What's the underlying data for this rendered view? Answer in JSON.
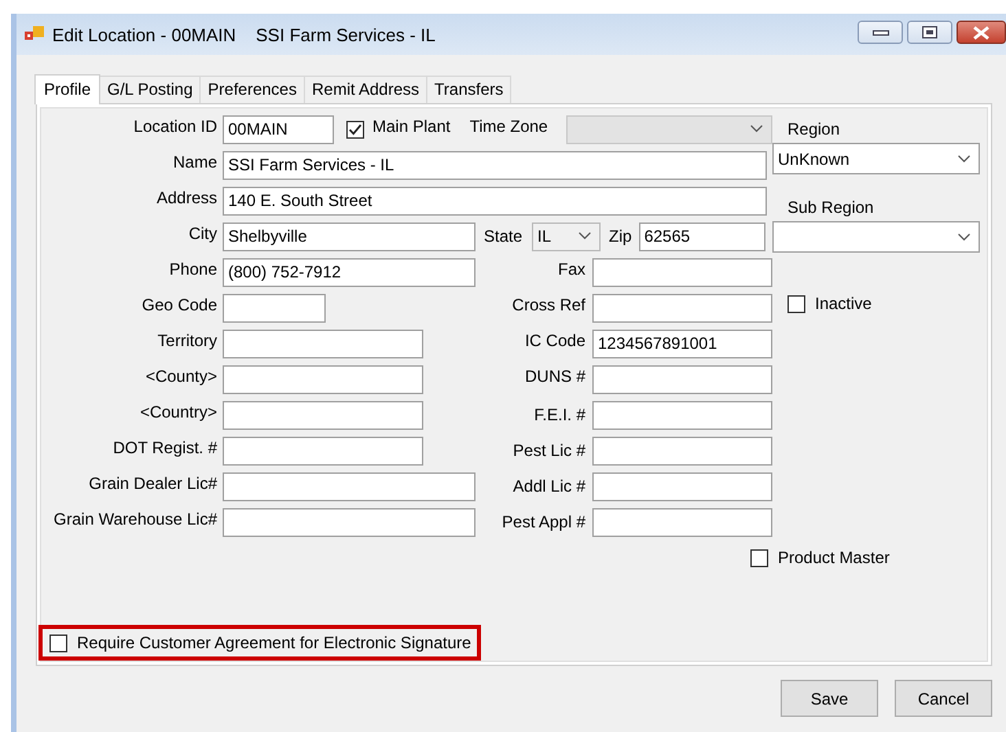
{
  "window": {
    "title": "Edit Location - 00MAIN    SSI Farm Services - IL"
  },
  "tabs": [
    {
      "label": "Profile",
      "selected": true
    },
    {
      "label": "G/L Posting",
      "selected": false
    },
    {
      "label": "Preferences",
      "selected": false
    },
    {
      "label": "Remit Address",
      "selected": false
    },
    {
      "label": "Transfers",
      "selected": false
    }
  ],
  "fields_left": [
    {
      "label": "Location ID",
      "value": "00MAIN"
    },
    {
      "label": "Name",
      "value": "SSI Farm Services - IL"
    },
    {
      "label": "Address",
      "value": "140 E. South Street"
    },
    {
      "label": "City",
      "value": "Shelbyville"
    },
    {
      "label": "Phone",
      "value": "(800) 752-7912"
    },
    {
      "label": "Geo Code"
    },
    {
      "label": "Territory"
    },
    {
      "label": "<County>"
    },
    {
      "label": "<Country>"
    },
    {
      "label": "DOT Regist. #"
    },
    {
      "label": "Grain Dealer Lic#"
    },
    {
      "label": "Grain Warehouse Lic#"
    }
  ],
  "main_plant": {
    "label": "Main Plant",
    "checked": true
  },
  "time_zone": {
    "label": "Time Zone",
    "disabled": true
  },
  "state": {
    "label": "State",
    "value": "IL"
  },
  "zip": {
    "label": "Zip",
    "value": "62565"
  },
  "fields_right": [
    {
      "label": "Fax"
    },
    {
      "label": "Cross Ref"
    },
    {
      "label": "IC Code",
      "value": "1234567891001"
    },
    {
      "label": "DUNS #"
    },
    {
      "label": "F.E.I. #"
    },
    {
      "label": "Pest Lic #"
    },
    {
      "label": "Addl Lic #"
    },
    {
      "label": "Pest Appl #"
    }
  ],
  "region": {
    "label": "Region",
    "value": "UnKnown"
  },
  "sub_region": {
    "label": "Sub Region"
  },
  "inactive": {
    "label": "Inactive",
    "checked": false
  },
  "product_master": {
    "label": "Product Master",
    "checked": false
  },
  "e_signature": {
    "label": "Require Customer Agreement for Electronic Signature",
    "checked": false,
    "highlighted": true
  },
  "buttons": [
    "Save",
    "Cancel"
  ]
}
